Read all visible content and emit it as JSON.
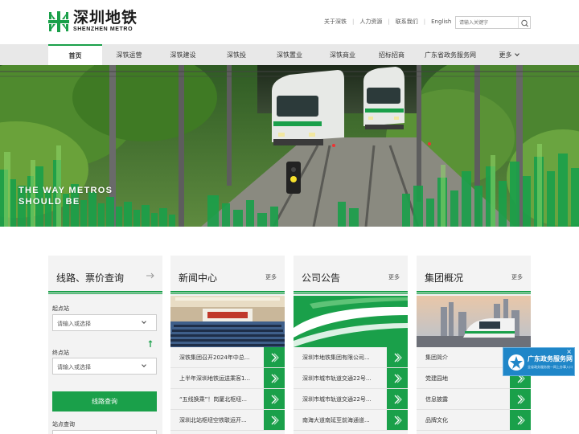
{
  "header": {
    "logo_cn": "深圳地铁",
    "logo_en": "SHENZHEN METRO",
    "top_links": [
      "关于深铁",
      "人力资源",
      "联系我们",
      "English"
    ],
    "search_placeholder": "请输入关键字"
  },
  "nav": {
    "items": [
      "首页",
      "深铁运营",
      "深铁建设",
      "深铁投",
      "深铁置业",
      "深铁商业",
      "招标招商",
      "广东省政务服务网",
      "更多"
    ]
  },
  "banner": {
    "slogan_line1": "THE WAY METROS",
    "slogan_line2": "SHOULD BE"
  },
  "route_query": {
    "title": "线路、票价查询",
    "start_label": "起点站",
    "start_placeholder": "请输入或选择",
    "end_label": "终点站",
    "end_placeholder": "请输入或选择",
    "button": "线路查询",
    "station_label": "站点查询"
  },
  "news": {
    "title": "新闻中心",
    "more": "更多",
    "items": [
      "深铁集团召开2024年中总...",
      "上半年深圳地铁运送乘客1...",
      "“五线换乘”！岗厦北枢纽...",
      "深圳北站枢纽空铁联运开..."
    ]
  },
  "notice": {
    "title": "公司公告",
    "more": "更多",
    "items": [
      "深圳市地铁集团有限公司...",
      "深圳市城市轨道交通22号...",
      "深圳市城市轨道交通22号...",
      "南海大道南延至前海通道..."
    ]
  },
  "group": {
    "title": "集团概况",
    "more": "更多",
    "items": [
      "集团简介",
      "党建园地",
      "信息披露",
      "品牌文化"
    ]
  },
  "float_widget": {
    "title": "广东政务服务网",
    "subtitle": "全省政务服务统一网上办事入口",
    "close": "×"
  },
  "colors": {
    "brand_green": "#1aa04a",
    "nav_bg": "#e8e8e8",
    "panel_bg": "#f3f3f3",
    "gov_blue": "#1f86c8"
  }
}
